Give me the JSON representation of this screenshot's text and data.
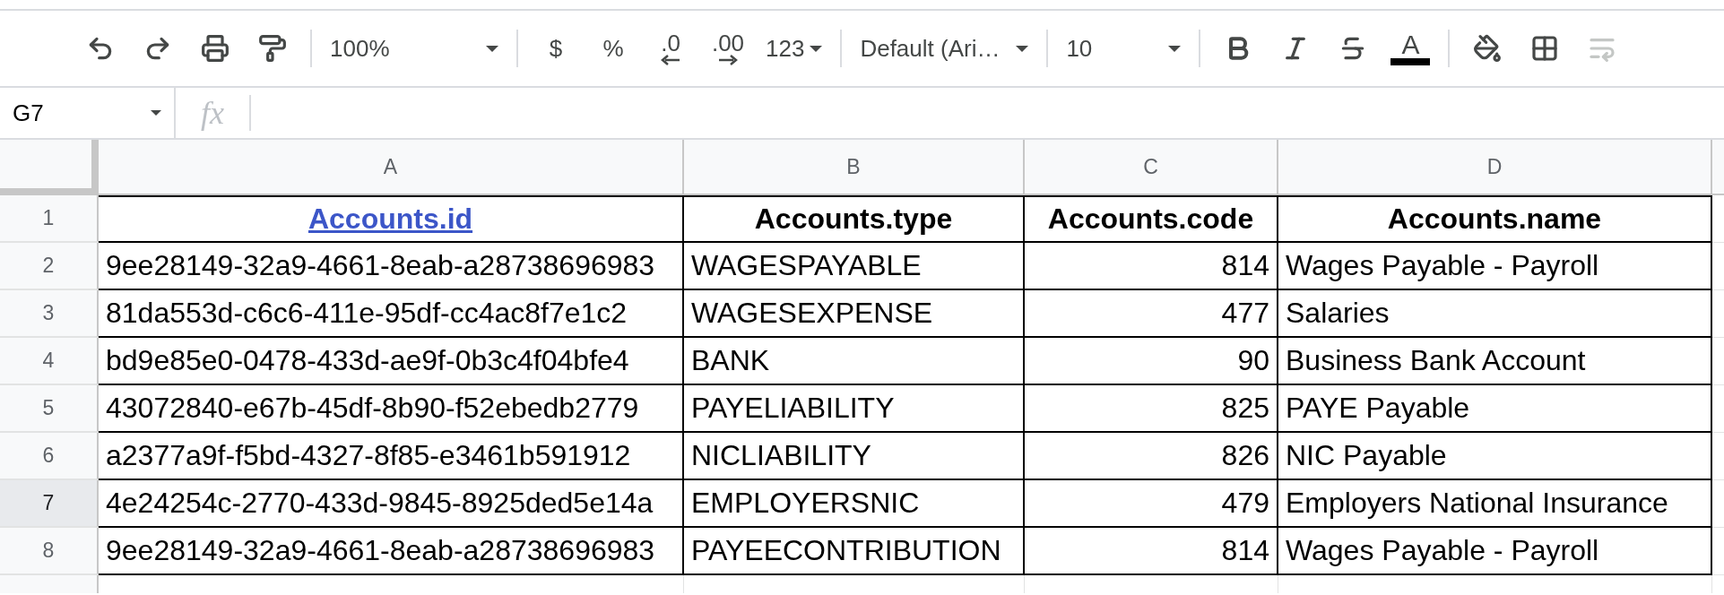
{
  "toolbar": {
    "zoom": "100%",
    "currency": "$",
    "percent": "%",
    "decrease_decimals": ".0",
    "increase_decimals": ".00",
    "number_format": "123",
    "font": "Default (Ari…",
    "font_size": "10",
    "text_color_letter": "A"
  },
  "name_box": "G7",
  "formula_label": "fx",
  "columns": [
    {
      "letter": "A"
    },
    {
      "letter": "B"
    },
    {
      "letter": "C"
    },
    {
      "letter": "D"
    }
  ],
  "rows": [
    {
      "number": "1",
      "selected": false,
      "cells": [
        {
          "text": "Accounts.id",
          "kind": "link"
        },
        {
          "text": "Accounts.type",
          "kind": "heading"
        },
        {
          "text": "Accounts.code",
          "kind": "heading"
        },
        {
          "text": "Accounts.name",
          "kind": "heading"
        }
      ]
    },
    {
      "number": "2",
      "selected": false,
      "cells": [
        {
          "text": "9ee28149-32a9-4661-8eab-a28738696983",
          "kind": "value"
        },
        {
          "text": "WAGESPAYABLE",
          "kind": "value"
        },
        {
          "text": "814",
          "kind": "number"
        },
        {
          "text": "Wages Payable - Payroll",
          "kind": "value"
        }
      ]
    },
    {
      "number": "3",
      "selected": false,
      "cells": [
        {
          "text": "81da553d-c6c6-411e-95df-cc4ac8f7e1c2",
          "kind": "value"
        },
        {
          "text": "WAGESEXPENSE",
          "kind": "value"
        },
        {
          "text": "477",
          "kind": "number"
        },
        {
          "text": "Salaries",
          "kind": "value"
        }
      ]
    },
    {
      "number": "4",
      "selected": false,
      "cells": [
        {
          "text": "bd9e85e0-0478-433d-ae9f-0b3c4f04bfe4",
          "kind": "value"
        },
        {
          "text": "BANK",
          "kind": "value"
        },
        {
          "text": "90",
          "kind": "number"
        },
        {
          "text": "Business Bank Account",
          "kind": "value"
        }
      ]
    },
    {
      "number": "5",
      "selected": false,
      "cells": [
        {
          "text": "43072840-e67b-45df-8b90-f52ebedb2779",
          "kind": "value"
        },
        {
          "text": "PAYELIABILITY",
          "kind": "value"
        },
        {
          "text": "825",
          "kind": "number"
        },
        {
          "text": "PAYE Payable",
          "kind": "value"
        }
      ]
    },
    {
      "number": "6",
      "selected": false,
      "cells": [
        {
          "text": "a2377a9f-f5bd-4327-8f85-e3461b591912",
          "kind": "value"
        },
        {
          "text": "NICLIABILITY",
          "kind": "value"
        },
        {
          "text": "826",
          "kind": "number"
        },
        {
          "text": "NIC Payable",
          "kind": "value"
        }
      ]
    },
    {
      "number": "7",
      "selected": true,
      "cells": [
        {
          "text": "4e24254c-2770-433d-9845-8925ded5e14a",
          "kind": "value"
        },
        {
          "text": "EMPLOYERSNIC",
          "kind": "value"
        },
        {
          "text": "479",
          "kind": "number"
        },
        {
          "text": "Employers National Insurance",
          "kind": "value"
        }
      ]
    },
    {
      "number": "8",
      "selected": false,
      "cells": [
        {
          "text": "9ee28149-32a9-4661-8eab-a28738696983",
          "kind": "value"
        },
        {
          "text": "PAYEECONTRIBUTION",
          "kind": "value"
        },
        {
          "text": "814",
          "kind": "number"
        },
        {
          "text": "Wages Payable - Payroll",
          "kind": "value"
        }
      ]
    }
  ]
}
